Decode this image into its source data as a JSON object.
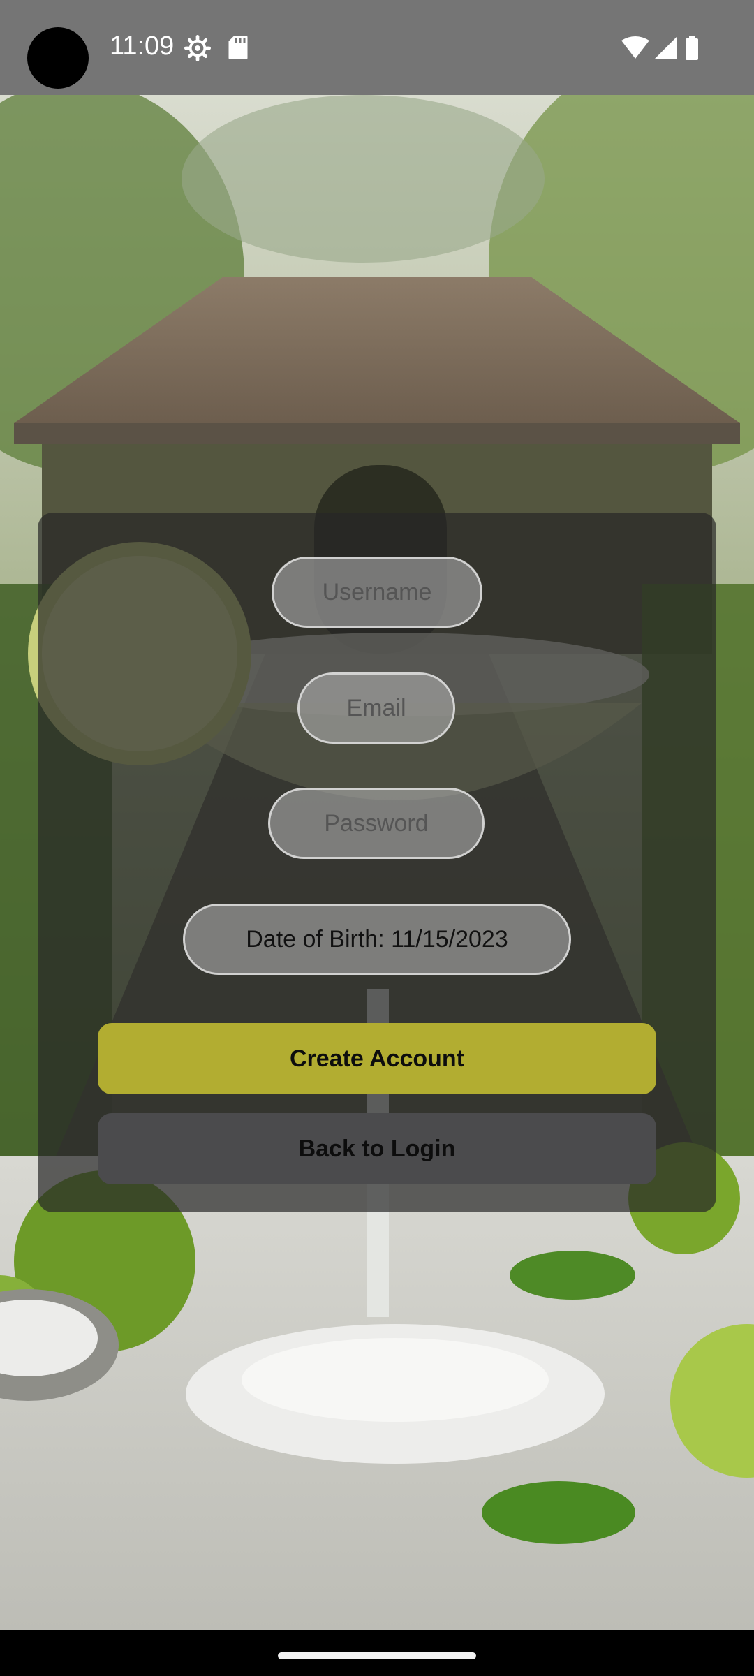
{
  "status_bar": {
    "time": "11:09",
    "left_icons": [
      "gear-icon",
      "sd-card-icon"
    ],
    "right_icons": [
      "wifi-icon",
      "signal-icon",
      "battery-icon"
    ]
  },
  "form": {
    "username_placeholder": "Username",
    "email_placeholder": "Email",
    "password_placeholder": "Password",
    "date_of_birth": "Date of Birth: 11/15/2023",
    "create_button": "Create Account",
    "back_button": "Back to Login"
  },
  "colors": {
    "primary_button": "#b2ad31",
    "secondary_button": "#4b4b4d",
    "card_overlay": "rgba(38,38,38,0.70)"
  }
}
